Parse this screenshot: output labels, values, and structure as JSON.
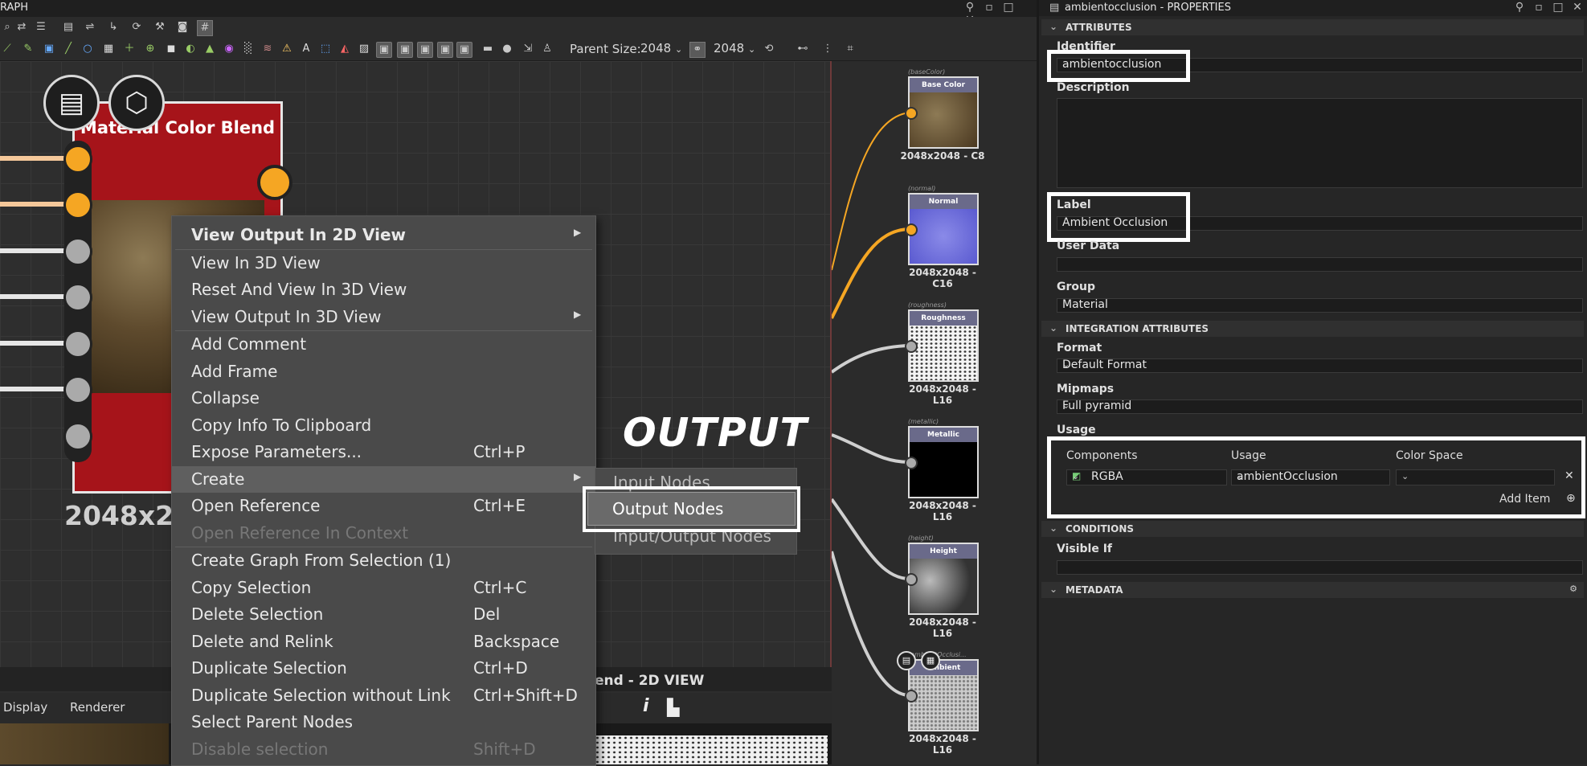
{
  "graph": {
    "title": "RAPH",
    "parent_size_label": "Parent Size:",
    "size_a": "2048",
    "size_b": "2048",
    "node_title": "Material Color Blend",
    "node_size": "2048x2048 - C8",
    "output_label": "OUTPUT",
    "outputs": [
      {
        "cap": "(baseColor)",
        "name": "Base Color",
        "size": "2048x2048 - C8",
        "pin": "#f5a623"
      },
      {
        "cap": "(normal)",
        "name": "Normal",
        "size": "2048x2048 - C16",
        "pin": "#f5a623"
      },
      {
        "cap": "(roughness)",
        "name": "Roughness",
        "size": "2048x2048 - L16",
        "pin": "#aaaaaa"
      },
      {
        "cap": "(metallic)",
        "name": "Metallic",
        "size": "2048x2048 - L16",
        "pin": "#aaaaaa"
      },
      {
        "cap": "(height)",
        "name": "Height",
        "size": "2048x2048 - L16",
        "pin": "#aaaaaa"
      },
      {
        "cap": "(ambientOcclusi...",
        "name": "Ambient Occlusion",
        "size": "2048x2048 - L16",
        "pin": "#aaaaaa"
      }
    ]
  },
  "view2d": {
    "title": "blend - 2D VIEW",
    "tabs": [
      "Display",
      "Renderer"
    ],
    "info_icon": "i"
  },
  "context_menu": {
    "items": [
      {
        "label": "View Output In 2D View",
        "shortcut": "",
        "submenu": true,
        "bold": true
      },
      {
        "label": "View In 3D View",
        "shortcut": ""
      },
      {
        "label": "Reset And View In 3D View",
        "shortcut": ""
      },
      {
        "label": "View Output In 3D View",
        "shortcut": "",
        "submenu": true
      },
      {
        "label": "Add Comment",
        "shortcut": ""
      },
      {
        "label": "Add Frame",
        "shortcut": ""
      },
      {
        "label": "Collapse",
        "shortcut": ""
      },
      {
        "label": "Copy Info To Clipboard",
        "shortcut": ""
      },
      {
        "label": "Expose Parameters...",
        "shortcut": "Ctrl+P"
      },
      {
        "label": "Create",
        "shortcut": "",
        "submenu": true,
        "highlight": true
      },
      {
        "label": "Open Reference",
        "shortcut": "Ctrl+E"
      },
      {
        "label": "Open Reference In Context",
        "shortcut": "",
        "disabled": true
      },
      {
        "label": "Create Graph From Selection (1)",
        "shortcut": ""
      },
      {
        "label": "Copy Selection",
        "shortcut": "Ctrl+C"
      },
      {
        "label": "Delete Selection",
        "shortcut": "Del"
      },
      {
        "label": "Delete and Relink",
        "shortcut": "Backspace"
      },
      {
        "label": "Duplicate Selection",
        "shortcut": "Ctrl+D"
      },
      {
        "label": "Duplicate Selection without Link",
        "shortcut": "Ctrl+Shift+D"
      },
      {
        "label": "Select Parent Nodes",
        "shortcut": ""
      },
      {
        "label": "Disable selection",
        "shortcut": "Shift+D",
        "disabled": true
      }
    ],
    "submenu": [
      "Input Nodes",
      "Output Nodes",
      "Input/Output Nodes"
    ]
  },
  "properties": {
    "title": "ambientocclusion - PROPERTIES",
    "sections": {
      "attributes": "ATTRIBUTES",
      "integration": "INTEGRATION ATTRIBUTES",
      "conditions": "CONDITIONS",
      "metadata": "METADATA"
    },
    "identifier_label": "Identifier",
    "identifier_value": "ambientocclusion",
    "description_label": "Description",
    "label_label": "Label",
    "label_value": "Ambient Occlusion",
    "userdata_label": "User Data",
    "group_label": "Group",
    "group_value": "Material",
    "format_label": "Format",
    "format_value": "Default Format",
    "mipmaps_label": "Mipmaps",
    "mipmaps_value": "Full pyramid",
    "usage_label": "Usage",
    "usage": {
      "headers": [
        "Components",
        "Usage",
        "Color Space"
      ],
      "components": "RGBA",
      "usage_value": "ambientOcclusion",
      "color_space": "",
      "add_item": "Add Item"
    },
    "visible_if_label": "Visible If"
  }
}
